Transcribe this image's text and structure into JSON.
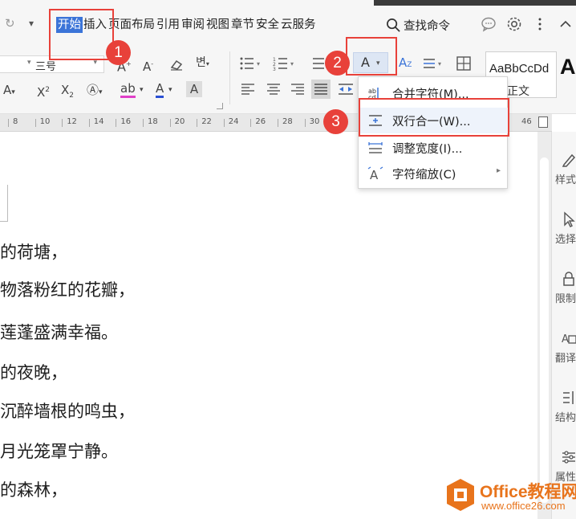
{
  "menu": {
    "tabs": [
      "开始",
      "插入",
      "页面布局",
      "引用",
      "审阅",
      "视图",
      "章节",
      "安全",
      "云服务"
    ],
    "active_index": 0,
    "search_label": "查找命令"
  },
  "ribbon": {
    "font_size_value": "三号",
    "style_preview": "AaBbCcDd",
    "style_name": "正文",
    "style_big_preview": "A"
  },
  "ruler": {
    "ticks": [
      "8",
      "10",
      "12",
      "14",
      "16",
      "18",
      "20",
      "22",
      "24",
      "26",
      "28",
      "30"
    ],
    "end_number": "46"
  },
  "document": {
    "lines": [
      "的荷塘，",
      "物落粉红的花瓣，",
      "莲蓬盛满幸福。",
      "的夜晚，",
      "沉醉墙根的鸣虫，",
      "月光笼罩宁静。",
      "的森林，"
    ]
  },
  "dropdown": {
    "items": [
      {
        "label": "合并字符(M)...",
        "icon": "merge-chars-icon",
        "submenu": false
      },
      {
        "label": "双行合一(W)...",
        "icon": "two-lines-in-one-icon",
        "submenu": false
      },
      {
        "label": "调整宽度(I)...",
        "icon": "adjust-width-icon",
        "submenu": false
      },
      {
        "label": "字符缩放(C)",
        "icon": "char-scale-icon",
        "submenu": true
      }
    ]
  },
  "sidebar": {
    "items": [
      {
        "label": "样式",
        "icon": "pen-icon"
      },
      {
        "label": "选择",
        "icon": "cursor-icon"
      },
      {
        "label": "限制",
        "icon": "lock-icon"
      },
      {
        "label": "翻译",
        "icon": "translate-icon"
      },
      {
        "label": "结构",
        "icon": "structure-icon"
      },
      {
        "label": "属性",
        "icon": "sliders-icon"
      }
    ]
  },
  "annotations": {
    "badges": [
      "1",
      "2",
      "3"
    ],
    "color": "#e8413a"
  },
  "watermark": {
    "title": "Office教程网",
    "url": "www.office26.com"
  },
  "colors": {
    "accent": "#3b74d8",
    "annotation": "#e8413a",
    "watermark": "#e8741c"
  }
}
